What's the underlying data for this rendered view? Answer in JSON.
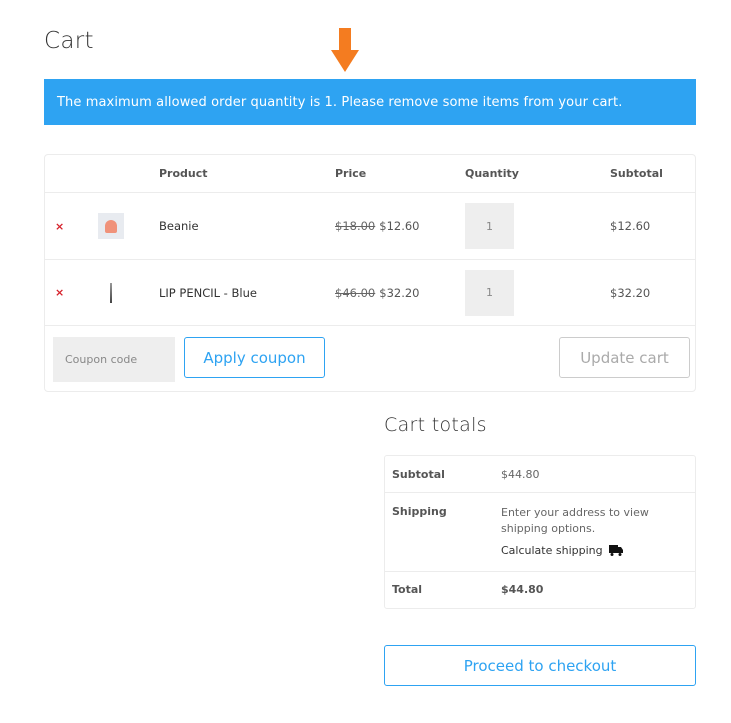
{
  "page": {
    "title": "Cart"
  },
  "notice": {
    "text": "The maximum allowed order quantity is 1. Please remove some items from your cart.",
    "background": "#2ea3f2"
  },
  "annotation": {
    "icon": "arrow-down-icon",
    "color": "#f47c20"
  },
  "cart": {
    "columns": [
      "",
      "",
      "Product",
      "Price",
      "Quantity",
      "Subtotal"
    ],
    "items": [
      {
        "remove": "×",
        "thumbnail": "beanie-thumbnail",
        "name": "Beanie",
        "old_price": "$18.00",
        "price": "$12.60",
        "quantity": "1",
        "subtotal": "$12.60"
      },
      {
        "remove": "×",
        "thumbnail": "lip-pencil-thumbnail",
        "name": "LIP PENCIL - Blue",
        "old_price": "$46.00",
        "price": "$32.20",
        "quantity": "1",
        "subtotal": "$32.20"
      }
    ],
    "coupon_placeholder": "Coupon code",
    "apply_coupon_label": "Apply coupon",
    "update_cart_label": "Update cart"
  },
  "totals": {
    "title": "Cart totals",
    "subtotal_label": "Subtotal",
    "subtotal_value": "$44.80",
    "shipping_label": "Shipping",
    "shipping_text": "Enter your address to view shipping options.",
    "calculate_shipping_label": "Calculate shipping",
    "total_label": "Total",
    "total_value": "$44.80",
    "checkout_label": "Proceed to checkout"
  }
}
